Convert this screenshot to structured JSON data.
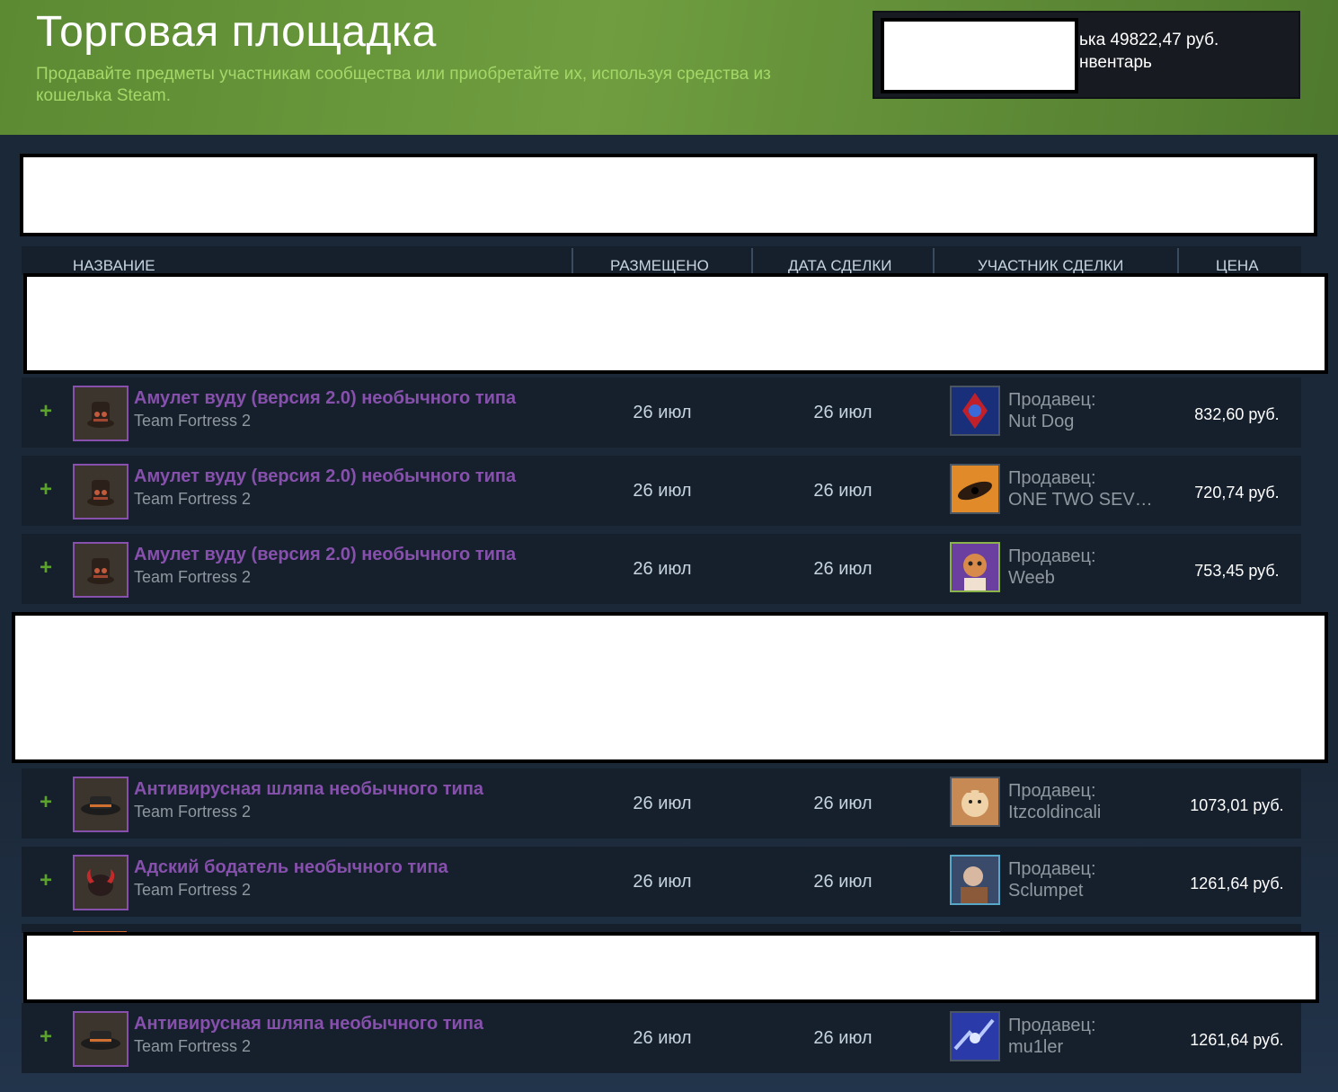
{
  "header": {
    "title": "Торговая площадка",
    "subtitle": "Продавайте предметы участникам сообщества или приобретайте их, используя средства из кошелька Steam.",
    "wallet_balance": "ька 49822,47 руб.",
    "wallet_inventory": "нвентарь"
  },
  "table": {
    "columns": {
      "name": "НАЗВАНИЕ",
      "listed": "РАЗМЕЩЕНО",
      "acted": "ДАТА СДЕЛКИ",
      "participant": "УЧАСТНИК СДЕЛКИ",
      "price": "ЦЕНА"
    },
    "rows": [
      {
        "plus": "+",
        "name": "Амулет вуду (версия 2.0) необычного типа",
        "game": "Team Fortress 2",
        "listed": "26 июл",
        "acted": "26 июл",
        "role": "Продавец:",
        "seller": "Nut Dog",
        "price": "832,60 руб.",
        "item_icon": "voodoo-hat",
        "avatar_colors": [
          "#1a2f7a",
          "#c0202a"
        ]
      },
      {
        "plus": "+",
        "name": "Амулет вуду (версия 2.0) необычного типа",
        "game": "Team Fortress 2",
        "listed": "26 июл",
        "acted": "26 июл",
        "role": "Продавец:",
        "seller": "ONE TWO SEV…",
        "price": "720,74 руб.",
        "item_icon": "voodoo-hat",
        "avatar_colors": [
          "#e08a2a",
          "#2a1a10"
        ]
      },
      {
        "plus": "+",
        "name": "Амулет вуду (версия 2.0) необычного типа",
        "game": "Team Fortress 2",
        "listed": "26 июл",
        "acted": "26 июл",
        "role": "Продавец:",
        "seller": "Weeb",
        "price": "753,45 руб.",
        "item_icon": "voodoo-hat",
        "avatar_colors": [
          "#6a3fa0",
          "#d88a4a"
        ]
      },
      {
        "plus": "+",
        "name": "Антивирусная шляпа необычного типа",
        "game": "Team Fortress 2",
        "listed": "26 июл",
        "acted": "26 июл",
        "role": "Продавец:",
        "seller": "Itzcoldincali",
        "price": "1073,01 руб.",
        "item_icon": "antivirus-hat",
        "avatar_colors": [
          "#c88a55",
          "#f0d2a8"
        ]
      },
      {
        "plus": "+",
        "name": "Адский бодатель необычного типа",
        "game": "Team Fortress 2",
        "listed": "26 июл",
        "acted": "26 июл",
        "role": "Продавец:",
        "seller": "Sclumpet",
        "price": "1261,64 руб.",
        "item_icon": "horns",
        "avatar_colors": [
          "#3a4a6a",
          "#d8b8a0"
        ]
      },
      {
        "plus": "+",
        "name": "Антивирусная шляпа необычного типа",
        "game": "Team Fortress 2",
        "listed": "26 июл",
        "acted": "26 июл",
        "role": "Продавец:",
        "seller": "mu1ler",
        "price": "1261,64 руб.",
        "item_icon": "antivirus-hat",
        "avatar_colors": [
          "#2a3aa8",
          "#b8c8ff"
        ]
      }
    ]
  }
}
